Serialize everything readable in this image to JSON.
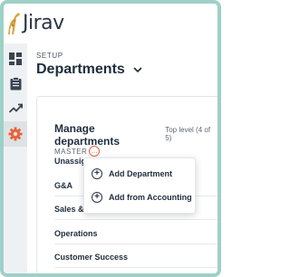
{
  "app": {
    "logo_text": "Jirav"
  },
  "header": {
    "breadcrumb": "SETUP",
    "title": "Departments"
  },
  "rail": {
    "items": [
      {
        "icon": "dashboard-icon"
      },
      {
        "icon": "clipboard-icon"
      },
      {
        "icon": "trend-up-icon"
      },
      {
        "icon": "gear-icon",
        "active": true
      }
    ]
  },
  "card": {
    "title": "Manage departments",
    "level": "Top level (4 of 5)",
    "master_label": "MASTER",
    "master_menu_glyph": "…",
    "departments": [
      "Unassig",
      "G&A",
      "Sales &",
      "Operations",
      "Customer Success"
    ]
  },
  "menu": {
    "items": [
      {
        "label": "Add Department",
        "icon": "plus-circle-icon"
      },
      {
        "label": "Add from Accounting",
        "icon": "plus-circle-icon"
      }
    ]
  },
  "colors": {
    "frame": "#9ed0c7",
    "accent_orange": "#e8623a",
    "text_dark": "#1f2d3d"
  }
}
